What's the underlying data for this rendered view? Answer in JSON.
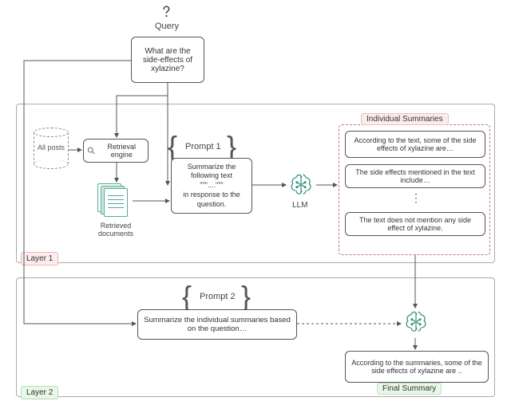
{
  "query": {
    "label": "Query",
    "text": "What are the side-effects of xylazine?"
  },
  "layer1": {
    "label": "Layer 1"
  },
  "layer2": {
    "label": "Layer 2"
  },
  "db": {
    "label": "All posts"
  },
  "retrieval": {
    "label": "Retrieval engine"
  },
  "retrieved_docs": {
    "label": "Retrieved documents"
  },
  "prompt1": {
    "label": "Prompt 1",
    "line1": "Summarize the following text",
    "line2": "\"\"\"....\"\"\"",
    "line3": "in response to the question."
  },
  "llm": {
    "label": "LLM"
  },
  "individual_summaries": {
    "title": "Individual Summaries",
    "s1": "According to the text, some of the side effects of xylazine are…",
    "s2": "The side effects mentioned in the text include…",
    "dots": "⋮",
    "s3": "The text does not mention any side effect of xylazine."
  },
  "prompt2": {
    "label": "Prompt 2",
    "text": "Summarize the individual summaries based on the question…"
  },
  "final_summary": {
    "title": "Final Summary",
    "text": "According to the summaries, some of the side effects of xylazine are .."
  }
}
